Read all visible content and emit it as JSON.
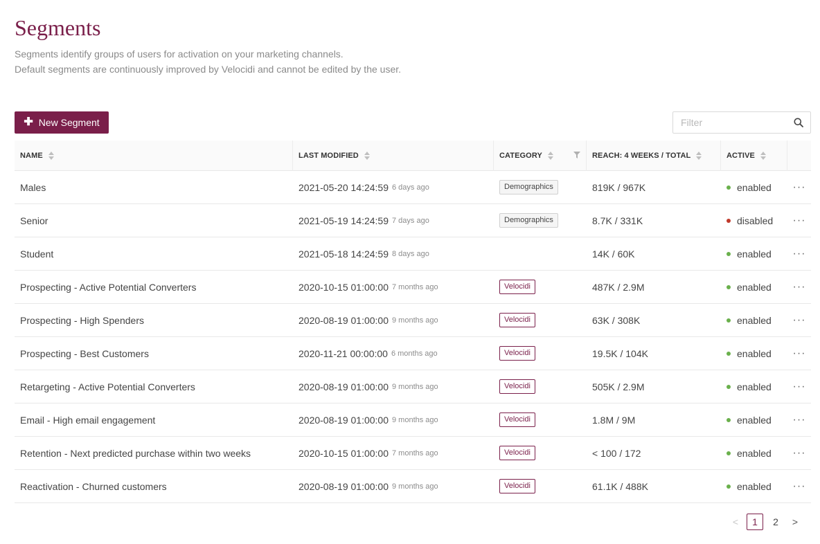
{
  "header": {
    "title": "Segments",
    "description_line1": "Segments identify groups of users for activation on your marketing channels.",
    "description_line2": "Default segments are continuously improved by Velocidi and cannot be edited by the user."
  },
  "toolbar": {
    "new_button_label": "New Segment",
    "new_button_icon": "plus-icon",
    "filter_placeholder": "Filter",
    "filter_value": "",
    "filter_icon": "search-icon"
  },
  "table": {
    "columns": {
      "name": "NAME",
      "last_modified": "LAST MODIFIED",
      "category": "CATEGORY",
      "reach": "REACH: 4 WEEKS / TOTAL",
      "active": "ACTIVE"
    },
    "rows": [
      {
        "name": "Males",
        "modified": "2021-05-20 14:24:59",
        "ago": "6 days ago",
        "category": "Demographics",
        "category_style": "demo",
        "reach": "819K / 967K",
        "status": "enabled"
      },
      {
        "name": "Senior",
        "modified": "2021-05-19 14:24:59",
        "ago": "7 days ago",
        "category": "Demographics",
        "category_style": "demo",
        "reach": "8.7K / 331K",
        "status": "disabled"
      },
      {
        "name": "Student",
        "modified": "2021-05-18 14:24:59",
        "ago": "8 days ago",
        "category": "",
        "category_style": "",
        "reach": "14K / 60K",
        "status": "enabled"
      },
      {
        "name": "Prospecting - Active Potential Converters",
        "modified": "2020-10-15 01:00:00",
        "ago": "7 months ago",
        "category": "Velocidi",
        "category_style": "velo",
        "reach": "487K / 2.9M",
        "status": "enabled"
      },
      {
        "name": "Prospecting - High Spenders",
        "modified": "2020-08-19 01:00:00",
        "ago": "9 months ago",
        "category": "Velocidi",
        "category_style": "velo",
        "reach": "63K / 308K",
        "status": "enabled"
      },
      {
        "name": "Prospecting - Best Customers",
        "modified": "2020-11-21 00:00:00",
        "ago": "6 months ago",
        "category": "Velocidi",
        "category_style": "velo",
        "reach": "19.5K / 104K",
        "status": "enabled"
      },
      {
        "name": "Retargeting - Active Potential Converters",
        "modified": "2020-08-19 01:00:00",
        "ago": "9 months ago",
        "category": "Velocidi",
        "category_style": "velo",
        "reach": "505K / 2.9M",
        "status": "enabled"
      },
      {
        "name": "Email - High email engagement",
        "modified": "2020-08-19 01:00:00",
        "ago": "9 months ago",
        "category": "Velocidi",
        "category_style": "velo",
        "reach": "1.8M / 9M",
        "status": "enabled"
      },
      {
        "name": "Retention - Next predicted purchase within two weeks",
        "modified": "2020-10-15 01:00:00",
        "ago": "7 months ago",
        "category": "Velocidi",
        "category_style": "velo",
        "reach": "< 100 / 172",
        "status": "enabled"
      },
      {
        "name": "Reactivation - Churned customers",
        "modified": "2020-08-19 01:00:00",
        "ago": "9 months ago",
        "category": "Velocidi",
        "category_style": "velo",
        "reach": "61.1K / 488K",
        "status": "enabled"
      }
    ],
    "more_label": "···"
  },
  "pagination": {
    "prev": "<",
    "pages": [
      "1",
      "2"
    ],
    "current": "1",
    "next": ">"
  },
  "colors": {
    "brand": "#7a1f4a",
    "enabled": "#6ab04c",
    "disabled": "#c0392b"
  }
}
